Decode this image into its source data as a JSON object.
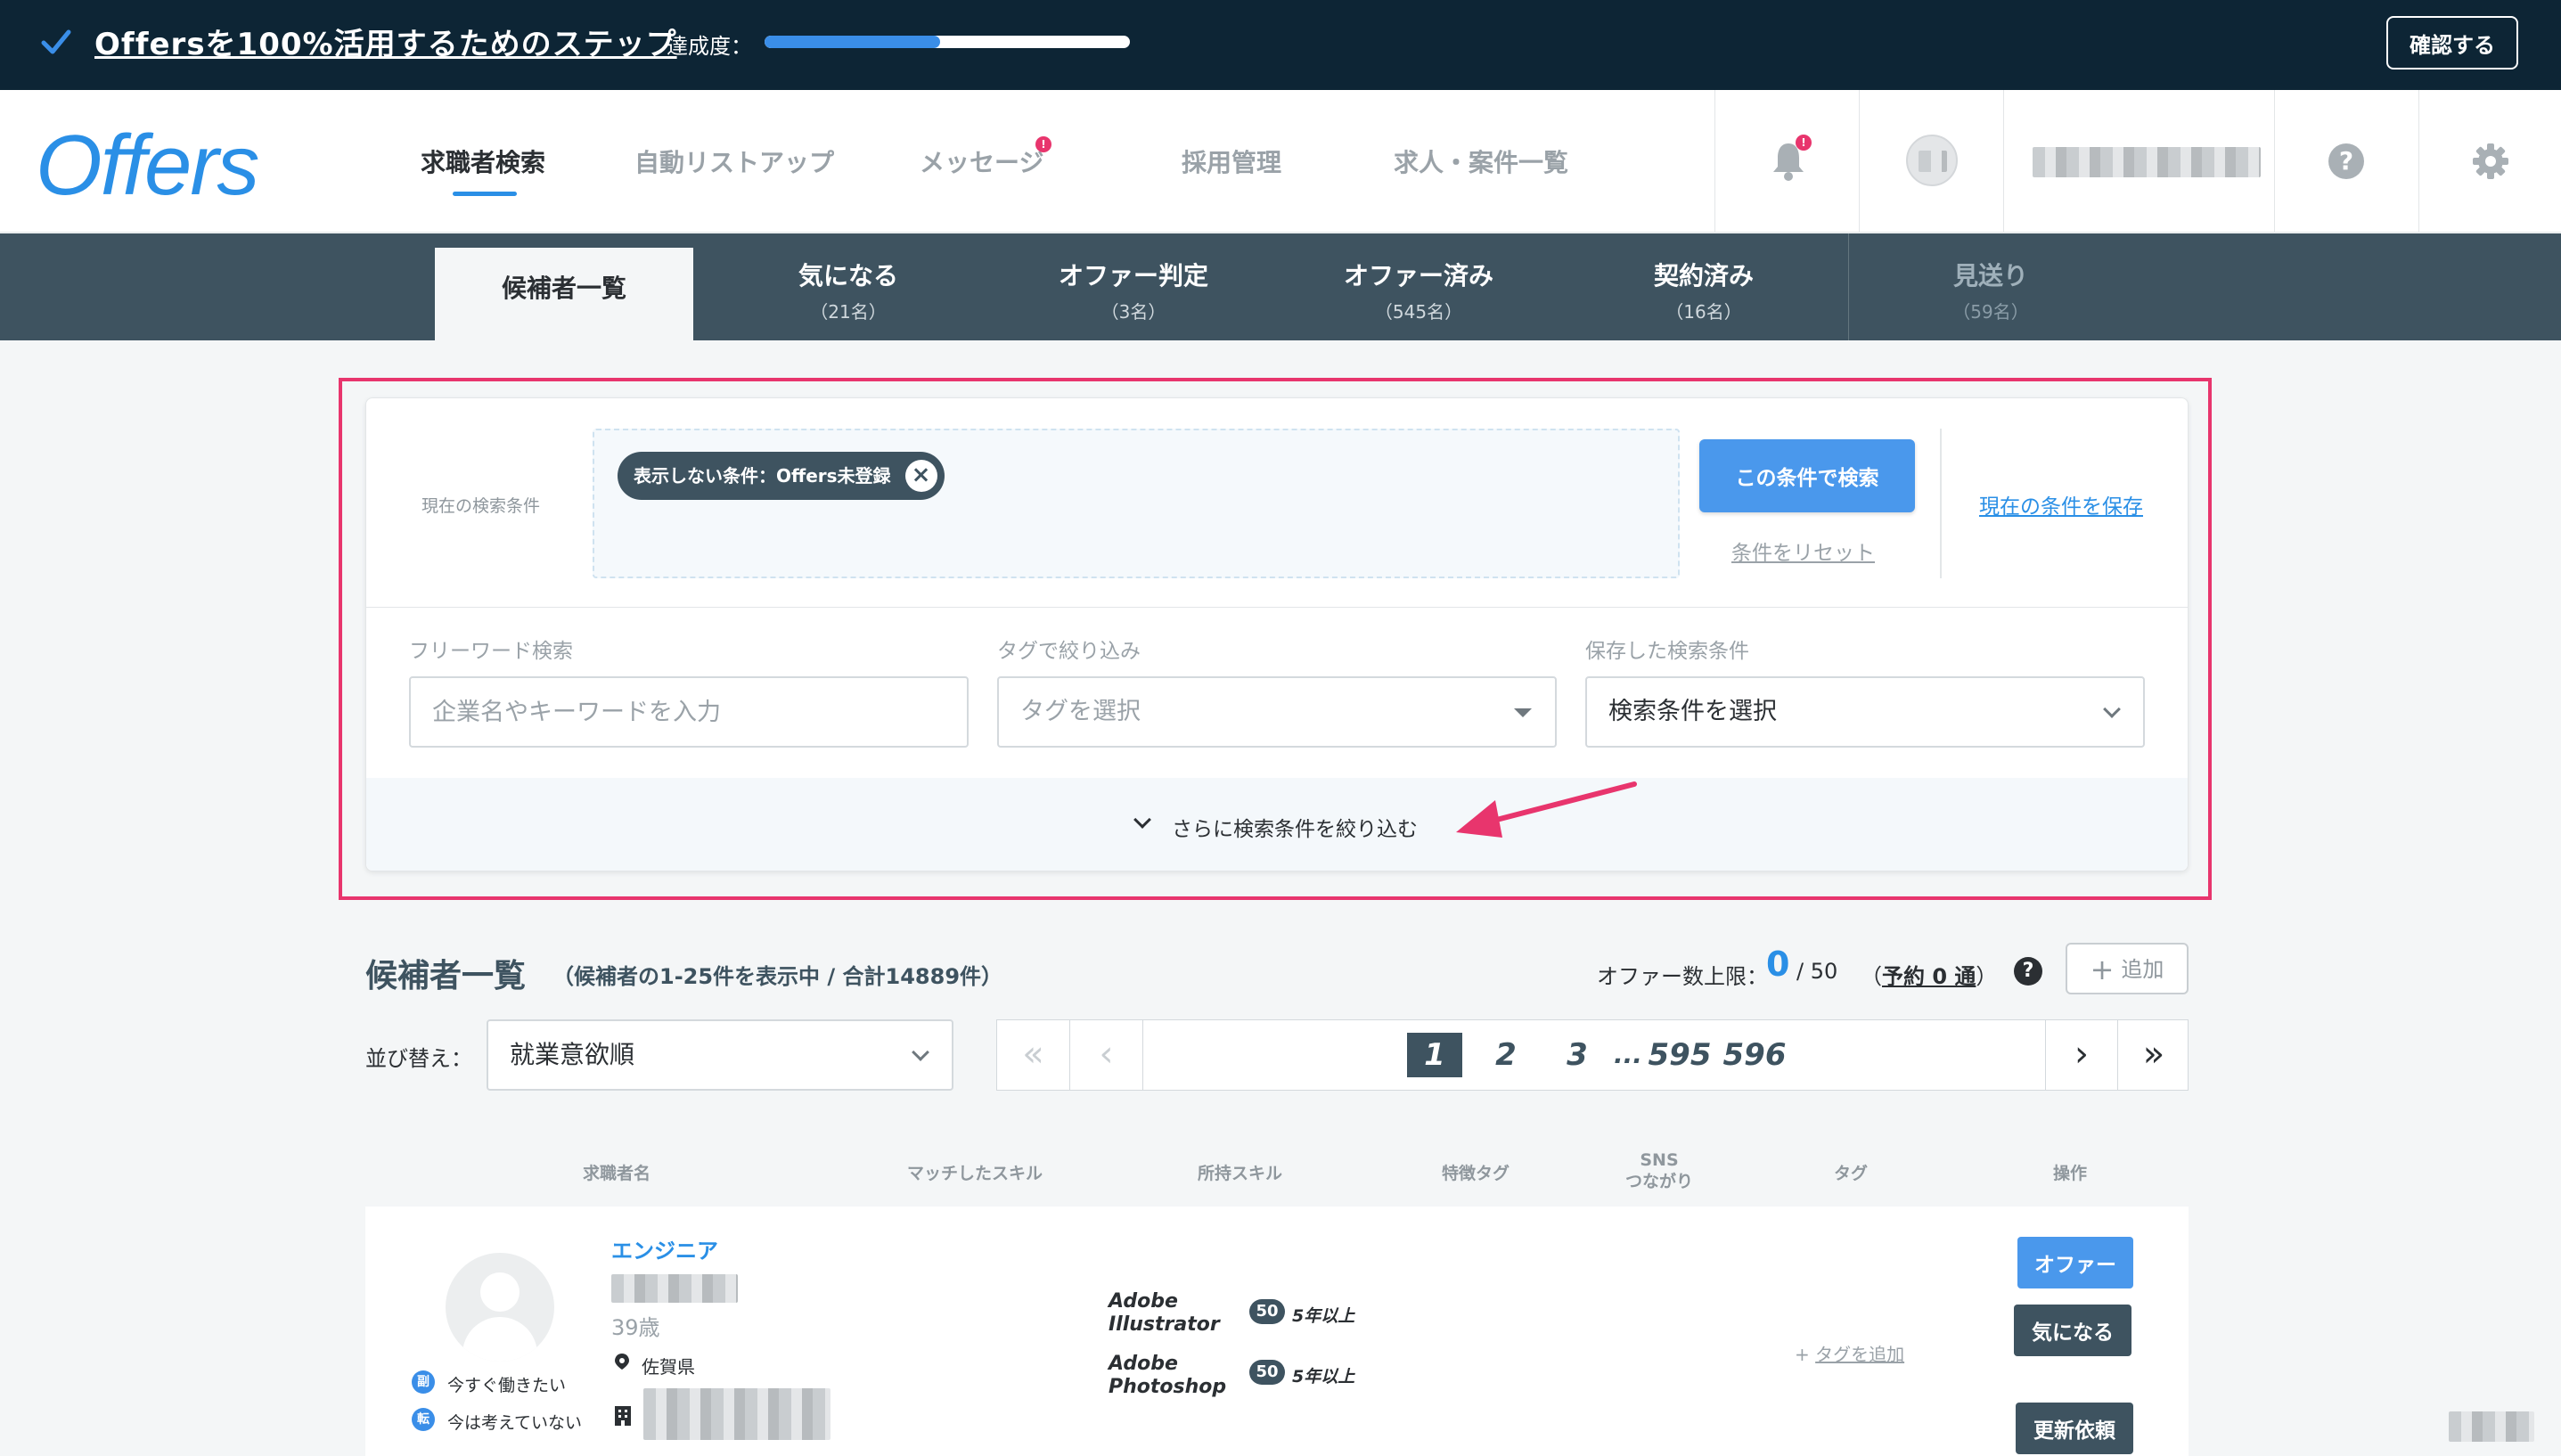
{
  "banner": {
    "title": "Offersを100%活用するためのステップ",
    "progress_label": "達成度：",
    "progress_fraction": 0.48,
    "confirm_label": "確認する"
  },
  "header": {
    "logo": "Offers",
    "nav": [
      {
        "label": "求職者検索",
        "active": true
      },
      {
        "label": "自動リストアップ",
        "active": false
      },
      {
        "label": "メッセージ",
        "active": false,
        "badge": "!"
      },
      {
        "label": "採用管理",
        "active": false
      },
      {
        "label": "求人・案件一覧",
        "active": false
      }
    ],
    "notification_badge": "!"
  },
  "subtabs": [
    {
      "label": "候補者一覧",
      "count": ""
    },
    {
      "label": "気になる",
      "count": "（21名）"
    },
    {
      "label": "オファー判定",
      "count": "（3名）"
    },
    {
      "label": "オファー済み",
      "count": "（545名）"
    },
    {
      "label": "契約済み",
      "count": "（16名）"
    },
    {
      "label": "見送り",
      "count": "（59名）"
    }
  ],
  "search": {
    "current_label": "現在の検索条件",
    "chip_label": "表示しない条件：Offers未登録",
    "search_button": "この条件で検索",
    "reset_link": "条件をリセット",
    "save_link": "現在の条件を保存",
    "freeword_label": "フリーワード検索",
    "freeword_placeholder": "企業名やキーワードを入力",
    "tag_label": "タグで絞り込み",
    "tag_placeholder": "タグを選択",
    "saved_label": "保存した検索条件",
    "saved_value": "検索条件を選択",
    "more_label": "さらに検索条件を絞り込む"
  },
  "list": {
    "title": "候補者一覧",
    "subtitle": "（候補者の1-25件を表示中 / 合計14889件）",
    "limit_label": "オファー数上限：",
    "limit_current": "0",
    "limit_max": "/ 50",
    "reserve_prefix": "（",
    "reserve_link": "予約 0 通",
    "reserve_suffix": "）",
    "help": "?",
    "add_label": "追加",
    "sort_label": "並び替え：",
    "sort_value": "就業意欲順"
  },
  "pagination": {
    "pages": [
      "1",
      "2",
      "3",
      "...",
      "595",
      "596"
    ],
    "current": "1"
  },
  "table_headers": {
    "name": "求職者名",
    "matched": "マッチしたスキル",
    "skills": "所持スキル",
    "feature_tags": "特徴タグ",
    "sns_1": "SNS",
    "sns_2": "つながり",
    "tags": "タグ",
    "actions": "操作"
  },
  "candidate": {
    "role": "エンジニア",
    "age": "39歳",
    "location": "佐賀県",
    "status_1_icon": "副",
    "status_1": "今すぐ働きたい",
    "status_2_icon": "転",
    "status_2": "今は考えていない",
    "skills": [
      {
        "line1": "Adobe",
        "line2": "Illustrator",
        "level": "50",
        "years": "5年以上"
      },
      {
        "line1": "Adobe",
        "line2": "Photoshop",
        "level": "50",
        "years": "5年以上"
      }
    ],
    "add_tag": "タグを追加",
    "offer_button": "オファー",
    "interest_button": "気になる",
    "update_button": "更新依頼"
  },
  "colors": {
    "banner_bg": "#0d2535",
    "accent": "#2a8fe6",
    "dark": "#3e5360",
    "highlight": "#e8356d"
  }
}
